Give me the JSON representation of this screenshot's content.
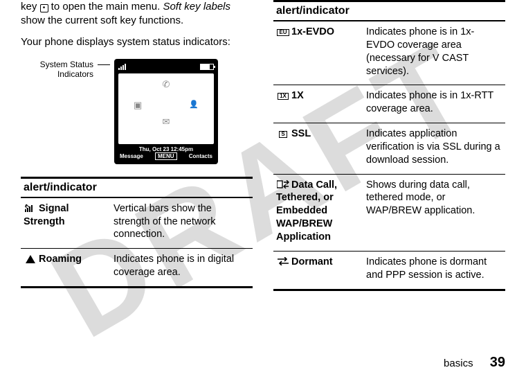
{
  "watermark": "DRAFT",
  "intro_part1": "key ",
  "intro_key_glyph": "•",
  "intro_part2": " to open the main menu. ",
  "intro_italic": "Soft key labels",
  "intro_part3": " show the current soft key functions.",
  "intro_line2": "Your phone displays system status indicators:",
  "screen_label": "System Status Indicators",
  "phone": {
    "datetime": "Thu, Oct 23 12:45pm",
    "soft_left": "Message",
    "soft_mid": "MENU",
    "soft_right": "Contacts"
  },
  "left_table": {
    "header": "alert/indicator",
    "rows": [
      {
        "name": "Signal Strength",
        "desc": "Vertical bars show the strength of the network connection."
      },
      {
        "name": "Roaming",
        "desc": "Indicates phone is in digital coverage area."
      }
    ]
  },
  "right_table": {
    "header": "alert/indicator",
    "rows": [
      {
        "name": "1x-EVDO",
        "desc": "Indicates phone is in 1x-EVDO coverage area (necessary for V CAST services)."
      },
      {
        "name": "1X",
        "desc": "Indicates phone is in 1x-RTT coverage area."
      },
      {
        "name": "SSL",
        "desc": "Indicates application verification is via SSL during a download session."
      },
      {
        "name": "Data Call, Tethered, or Embedded WAP/BREW Application",
        "desc": "Shows during data call, tethered mode, or WAP/BREW application."
      },
      {
        "name": "Dormant",
        "desc": "Indicates phone is dormant and PPP session is active."
      }
    ]
  },
  "footer_text": "basics",
  "footer_page": "39"
}
